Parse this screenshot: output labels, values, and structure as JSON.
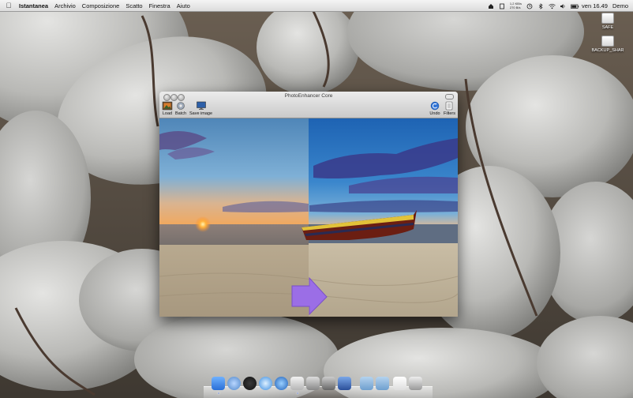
{
  "menubar": {
    "app_name": "Istantanea",
    "menus": [
      "Archivio",
      "Composizione",
      "Scatto",
      "Finestra",
      "Aiuto"
    ],
    "network_up": "1,2 KB/s",
    "network_down": "270 B/s",
    "clock": "ven 16.49",
    "user": "Demo"
  },
  "desktop": {
    "drives": [
      {
        "label": "SAFE"
      },
      {
        "label": "BACKUP_SHAR"
      }
    ]
  },
  "window": {
    "title": "PhotoEnhancer Core",
    "toolbar": {
      "load_label": "Load",
      "batch_label": "Batch",
      "save_label": "Save image",
      "undo_label": "Undo",
      "filters_label": "Filters"
    }
  },
  "dock": {
    "items": [
      "finder",
      "mail",
      "dashboard",
      "safari",
      "itunes",
      "preview",
      "iphoto",
      "system-preferences",
      "xcode",
      "folder-applications",
      "folder-documents",
      "document",
      "trash"
    ]
  }
}
